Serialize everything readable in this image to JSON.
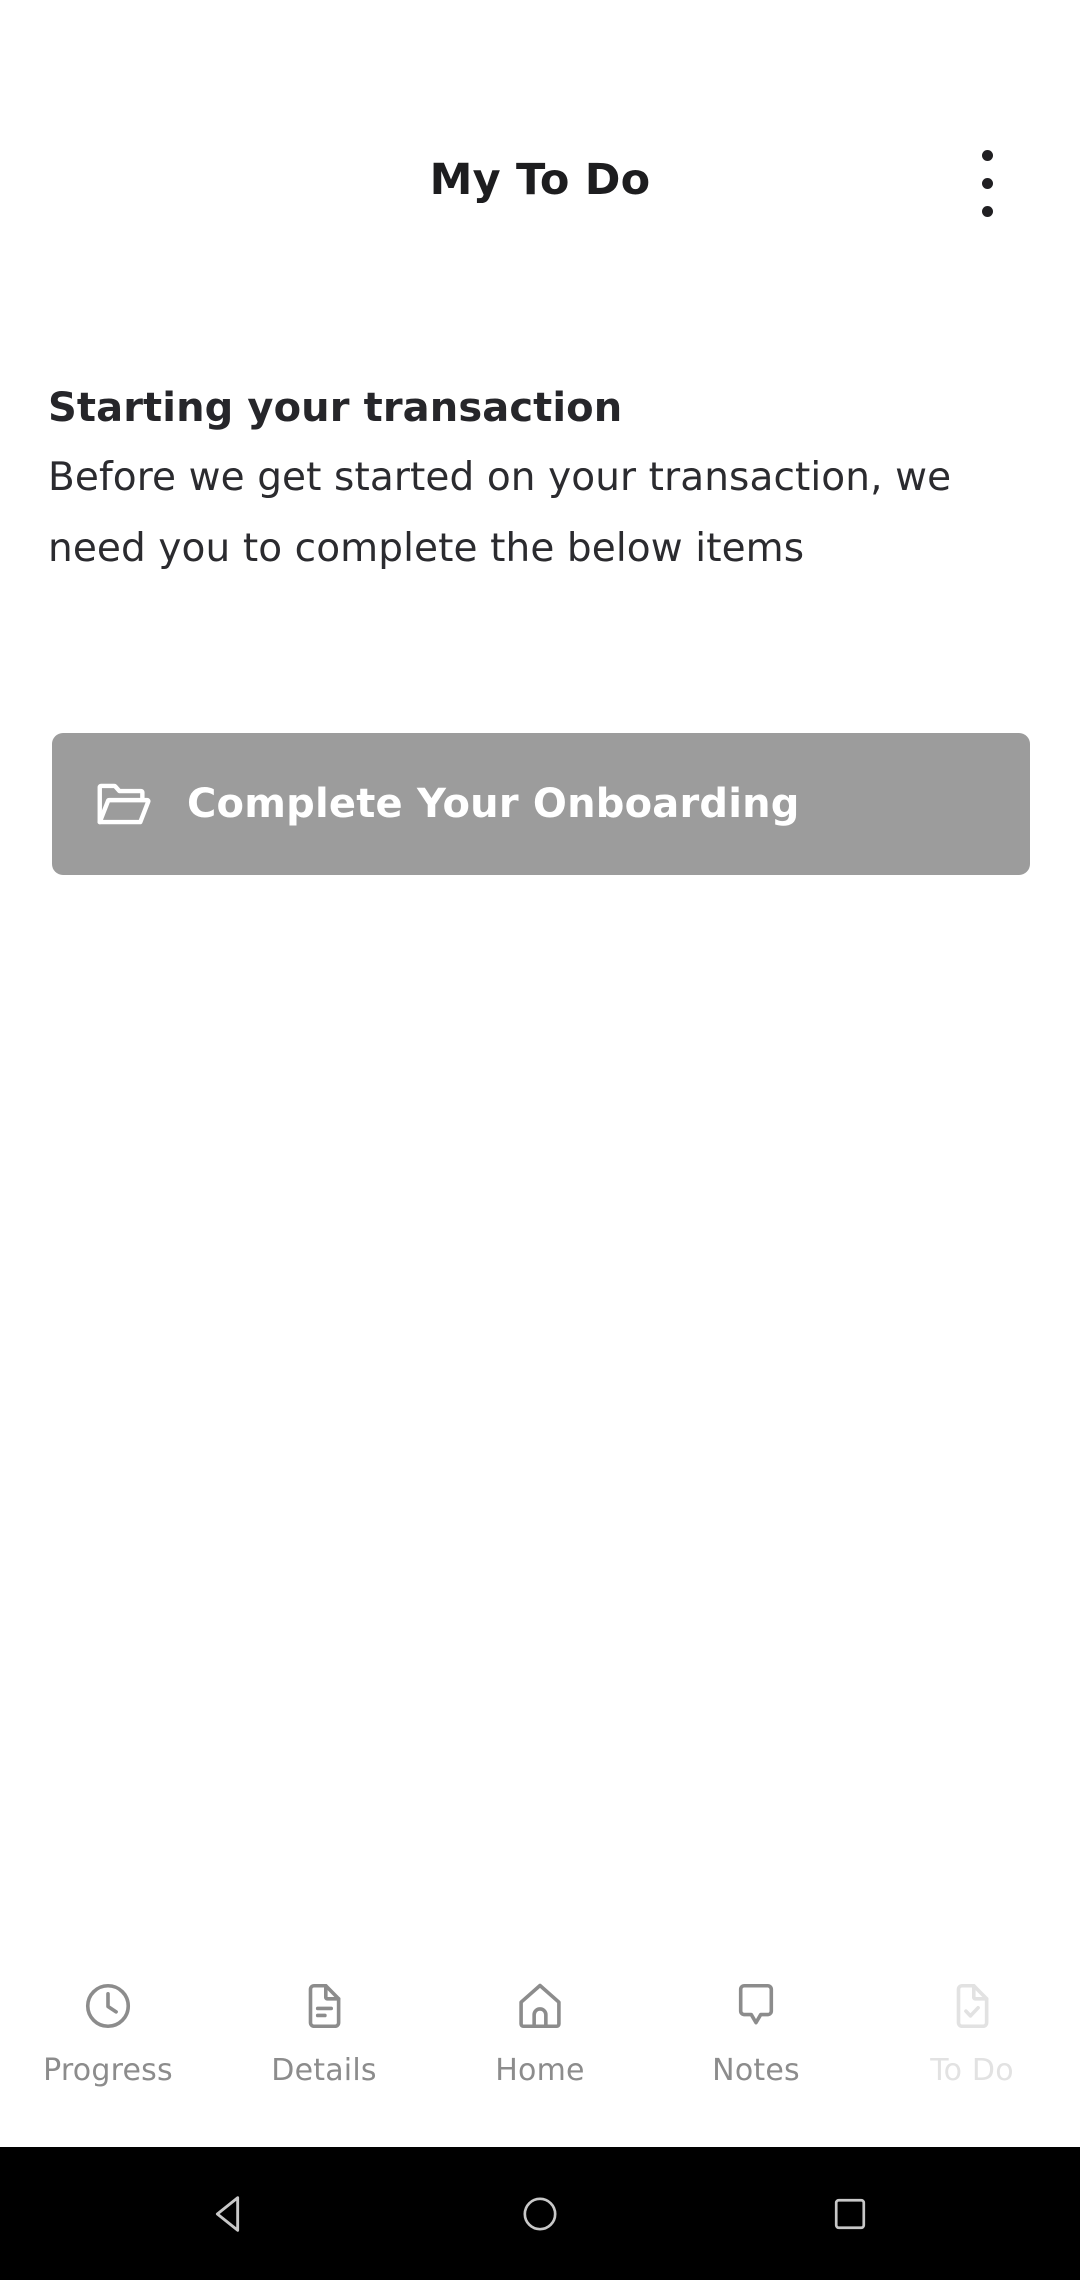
{
  "header": {
    "title": "My To Do",
    "overflow_menu_name": "more-options"
  },
  "intro": {
    "heading": "Starting your transaction",
    "body": "Before we get started on your transaction, we need you to complete the below items"
  },
  "task_card": {
    "label": "Complete Your Onboarding",
    "icon": "open-folder-icon",
    "background_color": "#9c9c9c",
    "text_color": "#ffffff"
  },
  "tab_bar": {
    "items": [
      {
        "label": "Progress",
        "icon": "clock-icon",
        "active": false
      },
      {
        "label": "Details",
        "icon": "document-icon",
        "active": false
      },
      {
        "label": "Home",
        "icon": "house-icon",
        "active": false
      },
      {
        "label": "Notes",
        "icon": "speech-bubble-icon",
        "active": false
      },
      {
        "label": "To Do",
        "icon": "document-check-icon",
        "active": true
      }
    ],
    "inactive_color": "#8c8c8c",
    "active_color": "#e2e2e2"
  },
  "system_nav": {
    "background_color": "#000000",
    "buttons": [
      {
        "name": "back-button",
        "icon": "triangle-left-icon"
      },
      {
        "name": "home-button",
        "icon": "circle-icon"
      },
      {
        "name": "recents-button",
        "icon": "square-icon"
      }
    ]
  }
}
